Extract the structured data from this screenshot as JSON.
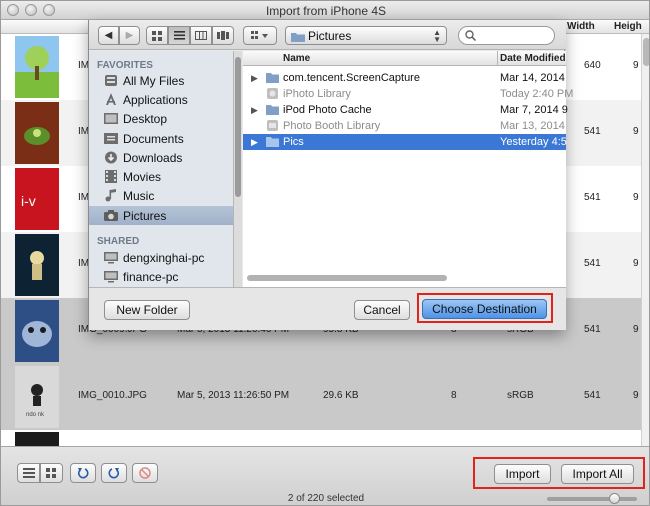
{
  "window": {
    "title": "Import from iPhone 4S"
  },
  "background_table": {
    "columns": {
      "width": "Width",
      "height": "Heigh"
    },
    "rows": [
      {
        "name": "IMG",
        "width": "640",
        "height": "9",
        "thumb": "#9fd05a"
      },
      {
        "name": "IMG",
        "width": "541",
        "height": "9",
        "thumb": "#5a8f2a"
      },
      {
        "name": "IMG",
        "width": "541",
        "height": "9",
        "thumb": "#c8141e"
      },
      {
        "name": "IMG",
        "width": "541",
        "height": "9",
        "thumb": "#0d2233"
      },
      {
        "name": "IMG_0009.JPG",
        "date": "Mar 5, 2013 11:26:46 PM",
        "size": "95.8 KB",
        "depth": "8",
        "profile": "sRGB",
        "width": "541",
        "height": "9",
        "thumb": "#2d4f86"
      },
      {
        "name": "IMG_0010.JPG",
        "date": "Mar 5, 2013 11:26:50 PM",
        "size": "29.6 KB",
        "depth": "8",
        "profile": "sRGB",
        "width": "541",
        "height": "9",
        "thumb": "#d9d9d9"
      }
    ]
  },
  "sheet": {
    "path_popup": "Pictures",
    "sidebar": {
      "favorites_header": "FAVORITES",
      "shared_header": "SHARED",
      "favorites": [
        "All My Files",
        "Applications",
        "Desktop",
        "Documents",
        "Downloads",
        "Movies",
        "Music",
        "Pictures"
      ],
      "shared": [
        "dengxinghai-pc",
        "finance-pc"
      ]
    },
    "file_list": {
      "col_name": "Name",
      "col_date": "Date Modified",
      "rows": [
        {
          "name": "com.tencent.ScreenCapture",
          "date": "Mar 14, 2014"
        },
        {
          "name": "iPhoto Library",
          "date": "Today 2:40 PM"
        },
        {
          "name": "iPod Photo Cache",
          "date": "Mar 7, 2014 9"
        },
        {
          "name": "Photo Booth Library",
          "date": "Mar 13, 2014"
        },
        {
          "name": "Pics",
          "date": "Yesterday 4:5"
        }
      ]
    },
    "new_folder_label": "New Folder",
    "cancel_label": "Cancel",
    "choose_label": "Choose Destination"
  },
  "bottom": {
    "import_label": "Import",
    "import_all_label": "Import All",
    "status": "2 of 220 selected"
  },
  "colors": {
    "selection": "#3b78d6",
    "highlight": "#e2231a"
  }
}
